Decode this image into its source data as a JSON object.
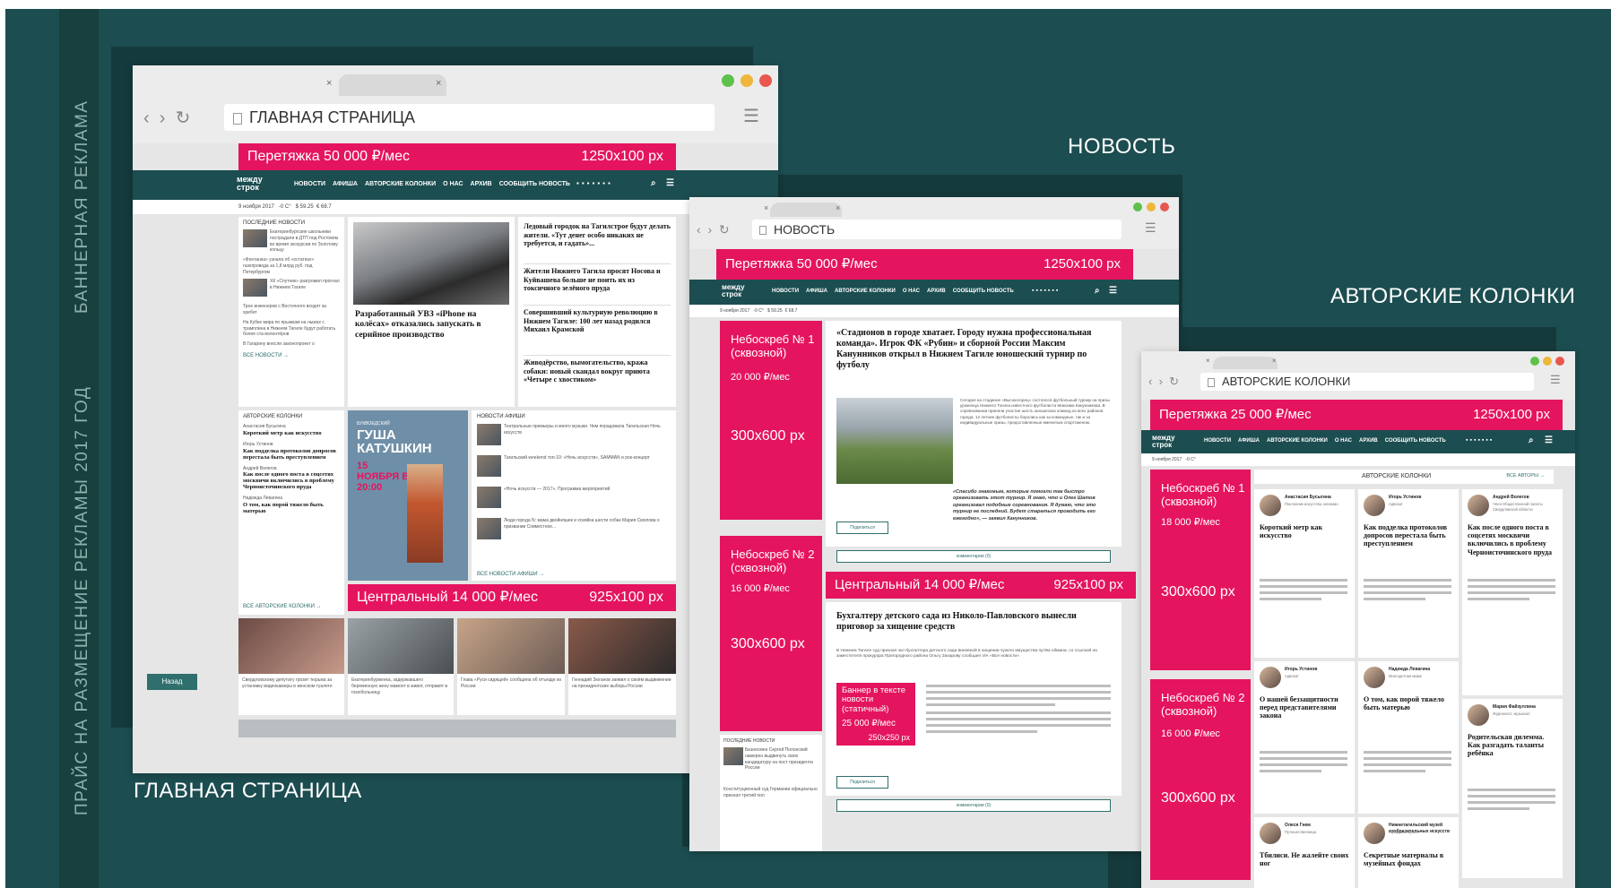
{
  "side_labels": {
    "banner": "БАННЕРНАЯ РЕКЛАМА",
    "price": "ПРАЙС НА РАЗМЕЩЕНИЕ РЕКЛАМЫ 2017 ГОД"
  },
  "captions": {
    "home": "ГЛАВНАЯ СТРАНИЦА",
    "news": "НОВОСТЬ",
    "columns": "АВТОРСКИЕ КОЛОНКИ"
  },
  "site": {
    "logo_top": "между",
    "logo_bottom": "строк",
    "menu": [
      "НОВОСТИ",
      "АФИША",
      "АВТОРСКИЕ КОЛОНКИ",
      "О НАС",
      "АРХИВ",
      "СООБЩИТЬ НОВОСТЬ"
    ],
    "date": "9 ноября 2017",
    "temp": "-0 С°",
    "usd": "$ 59.25",
    "eur": "€ 68.7"
  },
  "windows": {
    "home": {
      "url": "ГЛАВНАЯ СТРАНИЦА",
      "banner_left": "Перетяжка  50 000 ₽/мес",
      "banner_right": "1250x100 px",
      "latest_title": "ПОСЛЕДНИЕ НОВОСТИ",
      "latest": [
        "Екатеринбургские школьники пострадали в ДТП под Ростовом во время экскурсии по Золотому кольцу",
        "«Фонтанка» узнала об «остатках» газопровода за 1,8 млрд руб. под Петербургом",
        "ХК «Спутник» разгромил прогнал в Нижнем Тагиле",
        "Трое инженеров с Восточного входят за хребет",
        "На Кубке мира по прыжкам на лыжах с трамплина в Нижнем Тагиле будут работать более ста волонтёров",
        "В Гагарину внесли законопроект о"
      ],
      "all_news": "ВСЕ НОВОСТИ →",
      "lead_title": "Разработанный УВЗ «iPhone на колёсах» отказались запускать в серийное производство",
      "headlines": [
        "Ледовый городок на Тагилстрое будут делать жители. «Тут денег особо никаких не требуется, и гадать»...",
        "Жители Нижнего Тагила просят Носова и Куйвашева больше не поить их из токсичного зелёного пруда",
        "Совершивший культурную революцию в Нижнем Тагиле: 100 лет назад родился Михаил Крамской",
        "Живодёрство, вымогательство, кража собаки: новый скандал вокруг приюта «Четыре с хвостиком»"
      ],
      "columns_title": "АВТОРСКИЕ КОЛОНКИ",
      "column_items": [
        {
          "author": "Анастасия Бусыгина",
          "title": "Короткий метр как искусство"
        },
        {
          "author": "Игорь Устинов",
          "title": "Как подделка протоколов допросов перестала быть преступлением"
        },
        {
          "author": "Андрей Волегов",
          "title": "Как после одного поста в соцсетях москвичи включились в проблему Черноисточинского пруда"
        },
        {
          "author": "Надежда Левагина",
          "title": "О том, как порой тяжело быть матерью"
        }
      ],
      "all_columns": "ВСЕ АВТОРСКИЕ КОЛОНКИ →",
      "poster_small": "БУКВОЕДСКИЙ",
      "poster_name": "ГУША КАТУШКИН",
      "poster_date": "15 НОЯБРЯ В 20:00",
      "afisha_title": "НОВОСТИ АФИШИ",
      "afisha": [
        "Театральные премьеры и много музыки. Чем порадовала Тагильская Ночь искусств",
        "Тагильский weekend топ-10: «Ночь искусств», SAMMAN и рок-концерт",
        "«Ночь искусств — 2017». Программа мероприятий",
        "Люди города N: мама двойняшек и хозяйка шести собак Мария Смолова о призвании Совместное..."
      ],
      "all_afisha": "ВСЕ НОВОСТИ АФИШИ →",
      "central_left": "Центральный  14 000 ₽/мес",
      "central_right": "925x100 px",
      "bottom_news": [
        "Свердловскому депутату грозит тюрьма за установку видеокамеры в женском туалете",
        "Екатеринбурженка, задержавшего беременную жену мамонт в живот, отправят в психбольницу",
        "Глава «Руси сидящей» сообщила об отъезде из России",
        "Геннадий Зюганов заявил о своём выдвижении на президентские выборы России"
      ],
      "next_button": "Назад"
    },
    "news": {
      "url": "НОВОСТЬ",
      "banner_left": "Перетяжка  50 000 ₽/мес",
      "banner_right": "1250x100 px",
      "nb1_title": "Небоскреб № 1 (сквозной)",
      "nb1_price": "20 000 ₽/мес",
      "nb1_size": "300x600 px",
      "nb2_title": "Небоскреб № 2 (сквозной)",
      "nb2_price": "16 000 ₽/мес",
      "nb2_size": "300x600 px",
      "article_title": "«Стадионов в городе хватает. Городу нужна профессиональная команда». Игрок ФК «Рубин» и сборной России Максим Канунников открыл в Нижнем Тагиле юношеский турнир по футболу",
      "article_body": "Сегодня на стадионе «Высокогорец» состоялся футбольный турнир на призы уроженца Нижнего Тагила известного футболиста Максима Канунникова. В соревновании приняли участие шесть юношеских команд из всех районов города. 12 летние футболисты боролись как за командные, так и за индивидуальные призы, предоставленные именитым спортсменом.",
      "quote": "«Спасибо знакомым, которые помогли так быстро организовать этот турнир. Я знаю, что и Олег Шатов организовал подобные соревнования. Я думаю, что это турнир не последний. Будет стараться проводить его ежегодно», — заявил Канунников.",
      "share": "Поделиться",
      "comments": "комментарии (0)",
      "central_left": "Центральный  14 000 ₽/мес",
      "central_right": "925x100 px",
      "article2_title": "Бухгалтеру детского сада из Николо-Павловского вынесли приговор за хищение средств",
      "article2_body": "В Нижнем Тагиле суд признал экс-бухгалтера детского сада виновной в хищении чужого имущества путём обмана, со ссылкой на заместителя прокурора Пригородного района Ольгу Захарову сообщает ИА «Все новости».",
      "text_banner_title": "Баннер в тексте новости (статичный)",
      "text_banner_price": "25 000 ₽/мес",
      "text_banner_size": "250x250 px",
      "latest_title": "ПОСЛЕДНИЕ НОВОСТИ",
      "latest": [
        "Бизнесмен Сергей Полонский намерен выдвинуть свою кандидатуру на пост президента России",
        "Конституционный суд Германии официально признал третий пол"
      ]
    },
    "columns": {
      "url": "АВТОРСКИЕ КОЛОНКИ",
      "banner_left": "Перетяжка  25 000 ₽/мес",
      "banner_right": "1250x100 px",
      "nb1_title": "Небоскреб № 1 (сквозной)",
      "nb1_price": "18 000 ₽/мес",
      "nb1_size": "300x600 px",
      "nb2_title": "Небоскреб № 2 (сквозной)",
      "nb2_price": "16 000 ₽/мес",
      "nb2_size": "300x600 px",
      "section_title": "АВТОРСКИЕ КОЛОНКИ",
      "all_authors": "ВСЕ АВТОРЫ →",
      "cards": [
        {
          "author": "Анастасия Бусыгина",
          "role": "Поклонник искусства, киноман",
          "title": "Короткий метр как искусство"
        },
        {
          "author": "Игорь Устинов",
          "role": "Адвокат",
          "title": "Как подделка протоколов допросов перестала быть преступлением"
        },
        {
          "author": "Андрей Волегов",
          "role": "Член Общественной палаты Свердловской области",
          "title": "Как после одного поста в соцсетях москвичи включились в проблему Черноисточинского пруда"
        },
        {
          "author": "Игорь Устинов",
          "role": "Адвокат",
          "title": "О нашей беззащитности перед представителями закона"
        },
        {
          "author": "Надежда Левагина",
          "role": "Многодетная мама",
          "title": "О том, как порой тяжело быть матерью"
        },
        {
          "author": "Мария Файзуллина",
          "role": "Журналист, музыкант",
          "title": "Родительская дилемма. Как разгадать таланты ребёнка"
        },
        {
          "author": "Олеся Гнем",
          "role": "Путешественница",
          "title": "Тбилиси. Не жалейте своих ног"
        },
        {
          "author": "Нижнетагильский музей изобразительных искусств",
          "role": "Городской музей",
          "title": "Секретные материалы в музейных фондах"
        }
      ]
    }
  },
  "colors": {
    "background": "#1c4d50",
    "accent": "#e5145f",
    "site_header": "#1c4d50"
  }
}
